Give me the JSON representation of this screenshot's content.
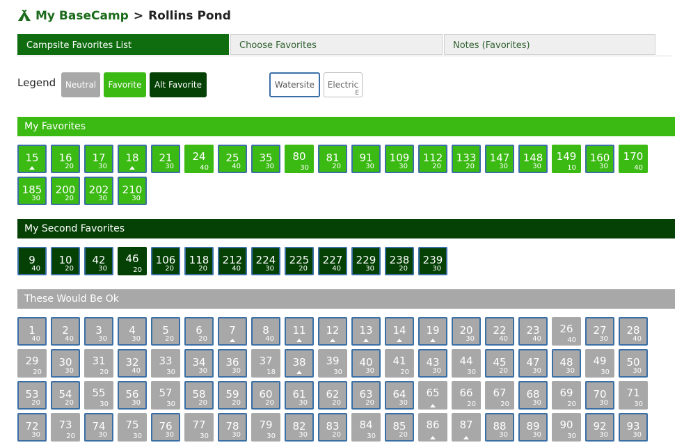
{
  "header": {
    "link": "My BaseCamp",
    "separator": ">",
    "current": "Rollins Pond",
    "icon": "tent-icon"
  },
  "tabs": [
    "Campsite Favorites List",
    "Choose Favorites",
    "Notes (Favorites)"
  ],
  "legend": {
    "label": "Legend",
    "neutral": "Neutral",
    "favorite": "Favorite",
    "alt_favorite": "Alt Favorite",
    "watersite": "Watersite",
    "electric": "Electric",
    "electric_sub": "E"
  },
  "colors": {
    "favorite": "#3cba14",
    "alt_favorite": "#054105",
    "neutral": "#a8a8a8",
    "watersite_border": "#3a6fa6",
    "brand": "#0f6d0f"
  },
  "sections": [
    {
      "title": "My Favorites",
      "sites": [
        {
          "n": "15",
          "a": "",
          "ws": true,
          "tri": true
        },
        {
          "n": "16",
          "a": "20",
          "ws": true
        },
        {
          "n": "17",
          "a": "30",
          "ws": true
        },
        {
          "n": "18",
          "a": "",
          "ws": true,
          "tri": true
        },
        {
          "n": "21",
          "a": "30",
          "ws": true
        },
        {
          "n": "24",
          "a": "40",
          "ws": false
        },
        {
          "n": "25",
          "a": "40",
          "ws": true
        },
        {
          "n": "35",
          "a": "30",
          "ws": true
        },
        {
          "n": "80",
          "a": "30",
          "ws": false
        },
        {
          "n": "81",
          "a": "20",
          "ws": true
        },
        {
          "n": "91",
          "a": "30",
          "ws": true
        },
        {
          "n": "109",
          "a": "30",
          "ws": true
        },
        {
          "n": "112",
          "a": "20",
          "ws": true
        },
        {
          "n": "133",
          "a": "20",
          "ws": true
        },
        {
          "n": "147",
          "a": "30",
          "ws": true
        },
        {
          "n": "148",
          "a": "30",
          "ws": true
        },
        {
          "n": "149",
          "a": "10",
          "ws": false
        },
        {
          "n": "160",
          "a": "30",
          "ws": true
        },
        {
          "n": "170",
          "a": "40",
          "ws": false
        },
        {
          "n": "185",
          "a": "30",
          "ws": true
        },
        {
          "n": "200",
          "a": "20",
          "ws": true
        },
        {
          "n": "202",
          "a": "30",
          "ws": true
        },
        {
          "n": "210",
          "a": "30",
          "ws": true
        }
      ]
    },
    {
      "title": "My Second Favorites",
      "sites": [
        {
          "n": "9",
          "a": "40",
          "ws": true
        },
        {
          "n": "10",
          "a": "20",
          "ws": true
        },
        {
          "n": "42",
          "a": "30",
          "ws": true
        },
        {
          "n": "46",
          "a": "20",
          "ws": false
        },
        {
          "n": "106",
          "a": "20",
          "ws": true
        },
        {
          "n": "118",
          "a": "20",
          "ws": true
        },
        {
          "n": "212",
          "a": "40",
          "ws": true
        },
        {
          "n": "224",
          "a": "30",
          "ws": true
        },
        {
          "n": "225",
          "a": "20",
          "ws": true
        },
        {
          "n": "227",
          "a": "40",
          "ws": true
        },
        {
          "n": "229",
          "a": "30",
          "ws": true
        },
        {
          "n": "238",
          "a": "20",
          "ws": true
        },
        {
          "n": "239",
          "a": "30",
          "ws": true
        }
      ]
    },
    {
      "title": "These Would Be Ok",
      "sites": [
        {
          "n": "1",
          "a": "40",
          "ws": true
        },
        {
          "n": "2",
          "a": "40",
          "ws": true
        },
        {
          "n": "3",
          "a": "30",
          "ws": true
        },
        {
          "n": "4",
          "a": "30",
          "ws": true
        },
        {
          "n": "5",
          "a": "20",
          "ws": true
        },
        {
          "n": "6",
          "a": "20",
          "ws": true
        },
        {
          "n": "7",
          "a": "",
          "ws": true,
          "tri": true
        },
        {
          "n": "8",
          "a": "40",
          "ws": true
        },
        {
          "n": "11",
          "a": "",
          "ws": true,
          "tri": true
        },
        {
          "n": "12",
          "a": "",
          "ws": true,
          "tri": true
        },
        {
          "n": "13",
          "a": "",
          "ws": true,
          "tri": true
        },
        {
          "n": "14",
          "a": "",
          "ws": true,
          "tri": true
        },
        {
          "n": "19",
          "a": "",
          "ws": true,
          "tri": true
        },
        {
          "n": "20",
          "a": "30",
          "ws": true
        },
        {
          "n": "22",
          "a": "40",
          "ws": true
        },
        {
          "n": "23",
          "a": "40",
          "ws": true
        },
        {
          "n": "26",
          "a": "40",
          "ws": false
        },
        {
          "n": "27",
          "a": "30",
          "ws": true
        },
        {
          "n": "28",
          "a": "40",
          "ws": true
        },
        {
          "n": "29",
          "a": "20",
          "ws": false
        },
        {
          "n": "30",
          "a": "30",
          "ws": true
        },
        {
          "n": "31",
          "a": "20",
          "ws": false
        },
        {
          "n": "32",
          "a": "40",
          "ws": true
        },
        {
          "n": "33",
          "a": "30",
          "ws": false
        },
        {
          "n": "34",
          "a": "30",
          "ws": true
        },
        {
          "n": "36",
          "a": "30",
          "ws": true
        },
        {
          "n": "37",
          "a": "18",
          "ws": false
        },
        {
          "n": "38",
          "a": "",
          "ws": true,
          "tri": true
        },
        {
          "n": "39",
          "a": "30",
          "ws": false
        },
        {
          "n": "40",
          "a": "30",
          "ws": true
        },
        {
          "n": "41",
          "a": "20",
          "ws": false
        },
        {
          "n": "43",
          "a": "30",
          "ws": true
        },
        {
          "n": "44",
          "a": "30",
          "ws": false
        },
        {
          "n": "45",
          "a": "20",
          "ws": true
        },
        {
          "n": "47",
          "a": "30",
          "ws": true
        },
        {
          "n": "48",
          "a": "30",
          "ws": true
        },
        {
          "n": "49",
          "a": "30",
          "ws": false
        },
        {
          "n": "50",
          "a": "30",
          "ws": true
        },
        {
          "n": "53",
          "a": "20",
          "ws": true
        },
        {
          "n": "54",
          "a": "20",
          "ws": true
        },
        {
          "n": "55",
          "a": "30",
          "ws": false
        },
        {
          "n": "56",
          "a": "30",
          "ws": true
        },
        {
          "n": "57",
          "a": "30",
          "ws": false
        },
        {
          "n": "58",
          "a": "20",
          "ws": true
        },
        {
          "n": "59",
          "a": "20",
          "ws": true
        },
        {
          "n": "60",
          "a": "20",
          "ws": true
        },
        {
          "n": "61",
          "a": "30",
          "ws": true
        },
        {
          "n": "62",
          "a": "20",
          "ws": true
        },
        {
          "n": "63",
          "a": "20",
          "ws": true
        },
        {
          "n": "64",
          "a": "30",
          "ws": true
        },
        {
          "n": "65",
          "a": "",
          "ws": false,
          "tri": true
        },
        {
          "n": "66",
          "a": "20",
          "ws": false
        },
        {
          "n": "67",
          "a": "20",
          "ws": false
        },
        {
          "n": "68",
          "a": "30",
          "ws": true
        },
        {
          "n": "69",
          "a": "20",
          "ws": false
        },
        {
          "n": "70",
          "a": "30",
          "ws": true
        },
        {
          "n": "71",
          "a": "30",
          "ws": false
        },
        {
          "n": "72",
          "a": "30",
          "ws": true
        },
        {
          "n": "73",
          "a": "20",
          "ws": false
        },
        {
          "n": "74",
          "a": "30",
          "ws": true
        },
        {
          "n": "75",
          "a": "30",
          "ws": false
        },
        {
          "n": "76",
          "a": "30",
          "ws": true
        },
        {
          "n": "77",
          "a": "30",
          "ws": false
        },
        {
          "n": "78",
          "a": "30",
          "ws": true
        },
        {
          "n": "79",
          "a": "30",
          "ws": false
        },
        {
          "n": "82",
          "a": "30",
          "ws": true
        },
        {
          "n": "83",
          "a": "20",
          "ws": true
        },
        {
          "n": "84",
          "a": "30",
          "ws": false
        },
        {
          "n": "85",
          "a": "20",
          "ws": true
        },
        {
          "n": "86",
          "a": "",
          "ws": false,
          "tri": true
        },
        {
          "n": "87",
          "a": "",
          "ws": false,
          "tri": true
        },
        {
          "n": "88",
          "a": "30",
          "ws": true
        },
        {
          "n": "89",
          "a": "30",
          "ws": true
        },
        {
          "n": "90",
          "a": "30",
          "ws": false
        },
        {
          "n": "92",
          "a": "30",
          "ws": true
        },
        {
          "n": "93",
          "a": "30",
          "ws": true
        }
      ]
    }
  ]
}
